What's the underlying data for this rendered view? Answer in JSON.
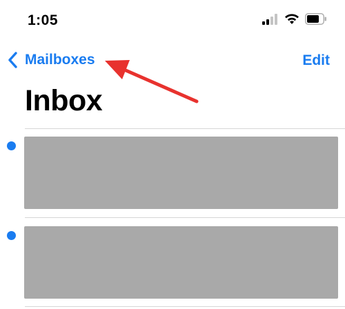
{
  "status_bar": {
    "time": "1:05"
  },
  "nav": {
    "back_label": "Mailboxes",
    "edit_label": "Edit"
  },
  "page": {
    "title": "Inbox"
  },
  "messages": [
    {
      "unread": true,
      "content": "redacted"
    },
    {
      "unread": true,
      "content": "redacted"
    }
  ],
  "colors": {
    "accent": "#1a7cf0",
    "unread_dot": "#1a7cf0",
    "redaction": "#a9a9a9",
    "annotation_arrow": "#e8322e"
  },
  "icons": {
    "back": "chevron-left-icon",
    "signal": "cellular-signal-icon",
    "wifi": "wifi-icon",
    "battery": "battery-icon"
  }
}
